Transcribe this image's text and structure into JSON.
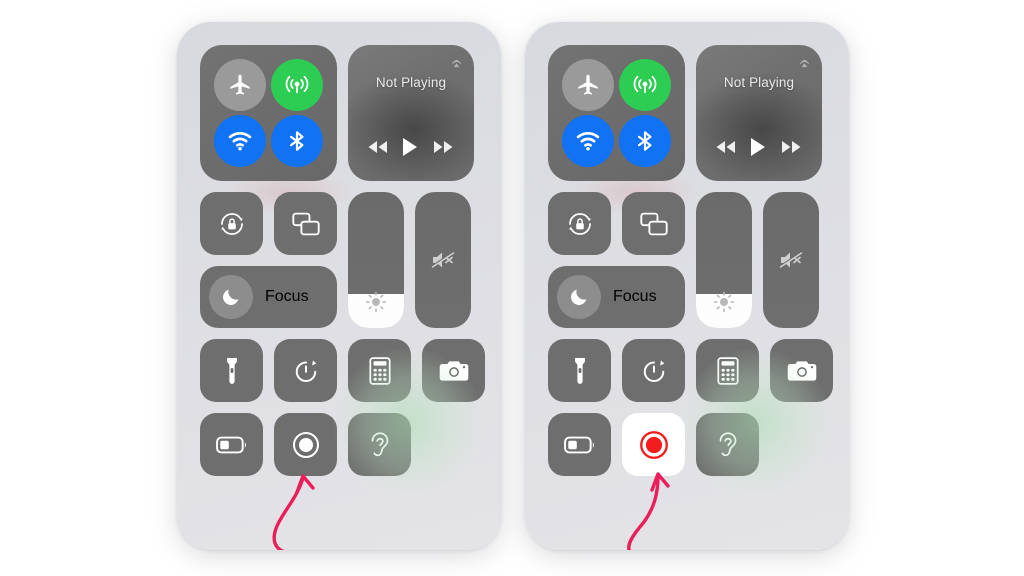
{
  "meta": {
    "subject": "iOS Control Center — Screen Recording button before and after activation"
  },
  "colors": {
    "tile_grey": "#6e6e6e",
    "toggle_off_grey": "#9a9a9a",
    "cellular_green": "#2dcc52",
    "wifi_blue": "#1172f4",
    "bluetooth_blue": "#1172f4",
    "record_active_bg": "#ffffff",
    "record_active_red": "#f41c1c",
    "arrow_pink": "#ea1e5a",
    "panel_bg": "#dedee2",
    "text_white": "#ffffff"
  },
  "panels": [
    {
      "id": "panel-left",
      "name": "control-center-before",
      "connectivity": {
        "airplane_mode": {
          "label": "Airplane Mode",
          "state": "off"
        },
        "cellular_data": {
          "label": "Cellular Data",
          "state": "on"
        },
        "wifi": {
          "label": "Wi-Fi",
          "state": "on"
        },
        "bluetooth": {
          "label": "Bluetooth",
          "state": "on"
        }
      },
      "media": {
        "status": "Not Playing",
        "airplay": "AirPlay",
        "rewind": "Rewind",
        "play": "Play",
        "forward": "Fast Forward"
      },
      "rotation_lock": {
        "label": "Portrait Orientation Lock",
        "state": "off"
      },
      "screen_mirroring": {
        "label": "Screen Mirroring",
        "state": "off"
      },
      "focus": {
        "label": "Focus",
        "state": "off"
      },
      "brightness": {
        "label": "Brightness",
        "value": 25
      },
      "volume": {
        "label": "Volume",
        "value": 0,
        "muted": true
      },
      "utilities": [
        {
          "name": "flashlight",
          "label": "Flashlight",
          "state": "off"
        },
        {
          "name": "timer",
          "label": "Timer",
          "state": "off"
        },
        {
          "name": "calculator",
          "label": "Calculator",
          "state": "off"
        },
        {
          "name": "camera",
          "label": "Camera",
          "state": "off"
        },
        {
          "name": "low-power-mode",
          "label": "Low Power Mode",
          "state": "off"
        },
        {
          "name": "screen-recording",
          "label": "Screen Recording",
          "state": "off"
        },
        {
          "name": "hearing",
          "label": "Hearing",
          "state": "off"
        }
      ]
    },
    {
      "id": "panel-right",
      "name": "control-center-after",
      "connectivity": {
        "airplane_mode": {
          "label": "Airplane Mode",
          "state": "off"
        },
        "cellular_data": {
          "label": "Cellular Data",
          "state": "on"
        },
        "wifi": {
          "label": "Wi-Fi",
          "state": "on"
        },
        "bluetooth": {
          "label": "Bluetooth",
          "state": "on"
        }
      },
      "media": {
        "status": "Not Playing",
        "airplay": "AirPlay",
        "rewind": "Rewind",
        "play": "Play",
        "forward": "Fast Forward"
      },
      "rotation_lock": {
        "label": "Portrait Orientation Lock",
        "state": "off"
      },
      "screen_mirroring": {
        "label": "Screen Mirroring",
        "state": "off"
      },
      "focus": {
        "label": "Focus",
        "state": "off"
      },
      "brightness": {
        "label": "Brightness",
        "value": 25
      },
      "volume": {
        "label": "Volume",
        "value": 0,
        "muted": true
      },
      "utilities": [
        {
          "name": "flashlight",
          "label": "Flashlight",
          "state": "off"
        },
        {
          "name": "timer",
          "label": "Timer",
          "state": "off"
        },
        {
          "name": "calculator",
          "label": "Calculator",
          "state": "off"
        },
        {
          "name": "camera",
          "label": "Camera",
          "state": "off"
        },
        {
          "name": "low-power-mode",
          "label": "Low Power Mode",
          "state": "off"
        },
        {
          "name": "screen-recording",
          "label": "Screen Recording",
          "state": "on"
        },
        {
          "name": "hearing",
          "label": "Hearing",
          "state": "off"
        }
      ]
    }
  ],
  "annotations": [
    {
      "name": "arrow-left",
      "points_to": "screen-recording",
      "style": "curved-hand-drawn-arrow"
    },
    {
      "name": "arrow-right",
      "points_to": "screen-recording",
      "style": "curved-hand-drawn-arrow"
    }
  ]
}
